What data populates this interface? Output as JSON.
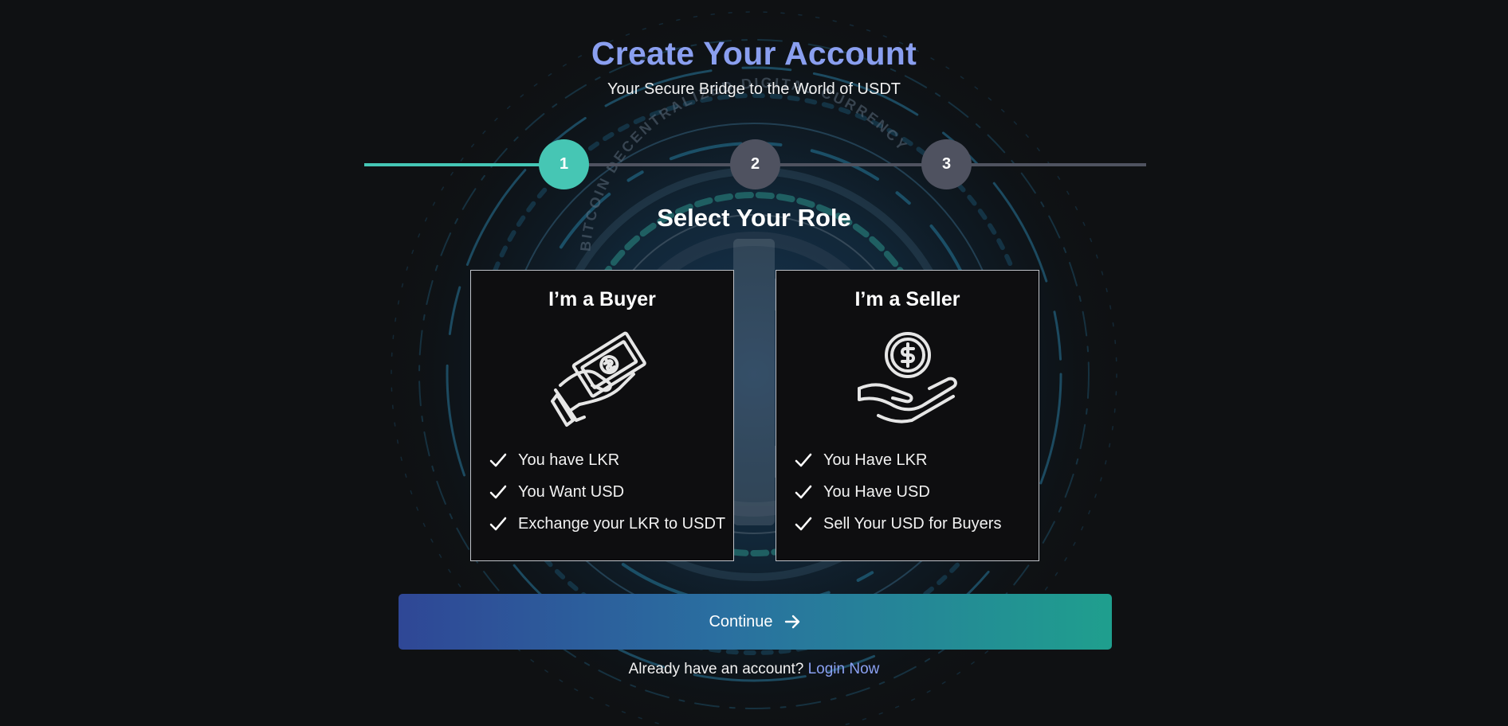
{
  "header": {
    "title": "Create Your Account",
    "subtitle": "Your Secure Bridge to the World of USDT"
  },
  "stepper": {
    "current_step": 1,
    "steps": [
      "1",
      "2",
      "3"
    ]
  },
  "section": {
    "title": "Select Your Role"
  },
  "roles": [
    {
      "title": "I’m a Buyer",
      "icon": "hand-giving-cash-icon",
      "features": [
        "You have LKR",
        "You Want USD",
        "Exchange your LKR to USDT"
      ]
    },
    {
      "title": "I’m a Seller",
      "icon": "hand-receiving-dollar-coin-icon",
      "features": [
        "You Have LKR",
        "You Have USD",
        "Sell Your USD for Buyers"
      ]
    }
  ],
  "continue_button": {
    "label": "Continue",
    "icon": "arrow-right-icon"
  },
  "login_prompt": {
    "text": "Already have an account?",
    "link_label": "Login Now"
  },
  "background": {
    "decorative_text": "BITCOIN DECENTRALIZED DIGITAL CURRENCY"
  },
  "colors": {
    "background": "#0f1113",
    "title": "#8a9ff0",
    "accent_teal": "#46c6b4",
    "step_inactive": "#4f5260",
    "link": "#8aa0f2",
    "button_gradient_start": "#2f4796",
    "button_gradient_end": "#1f9f8e"
  }
}
